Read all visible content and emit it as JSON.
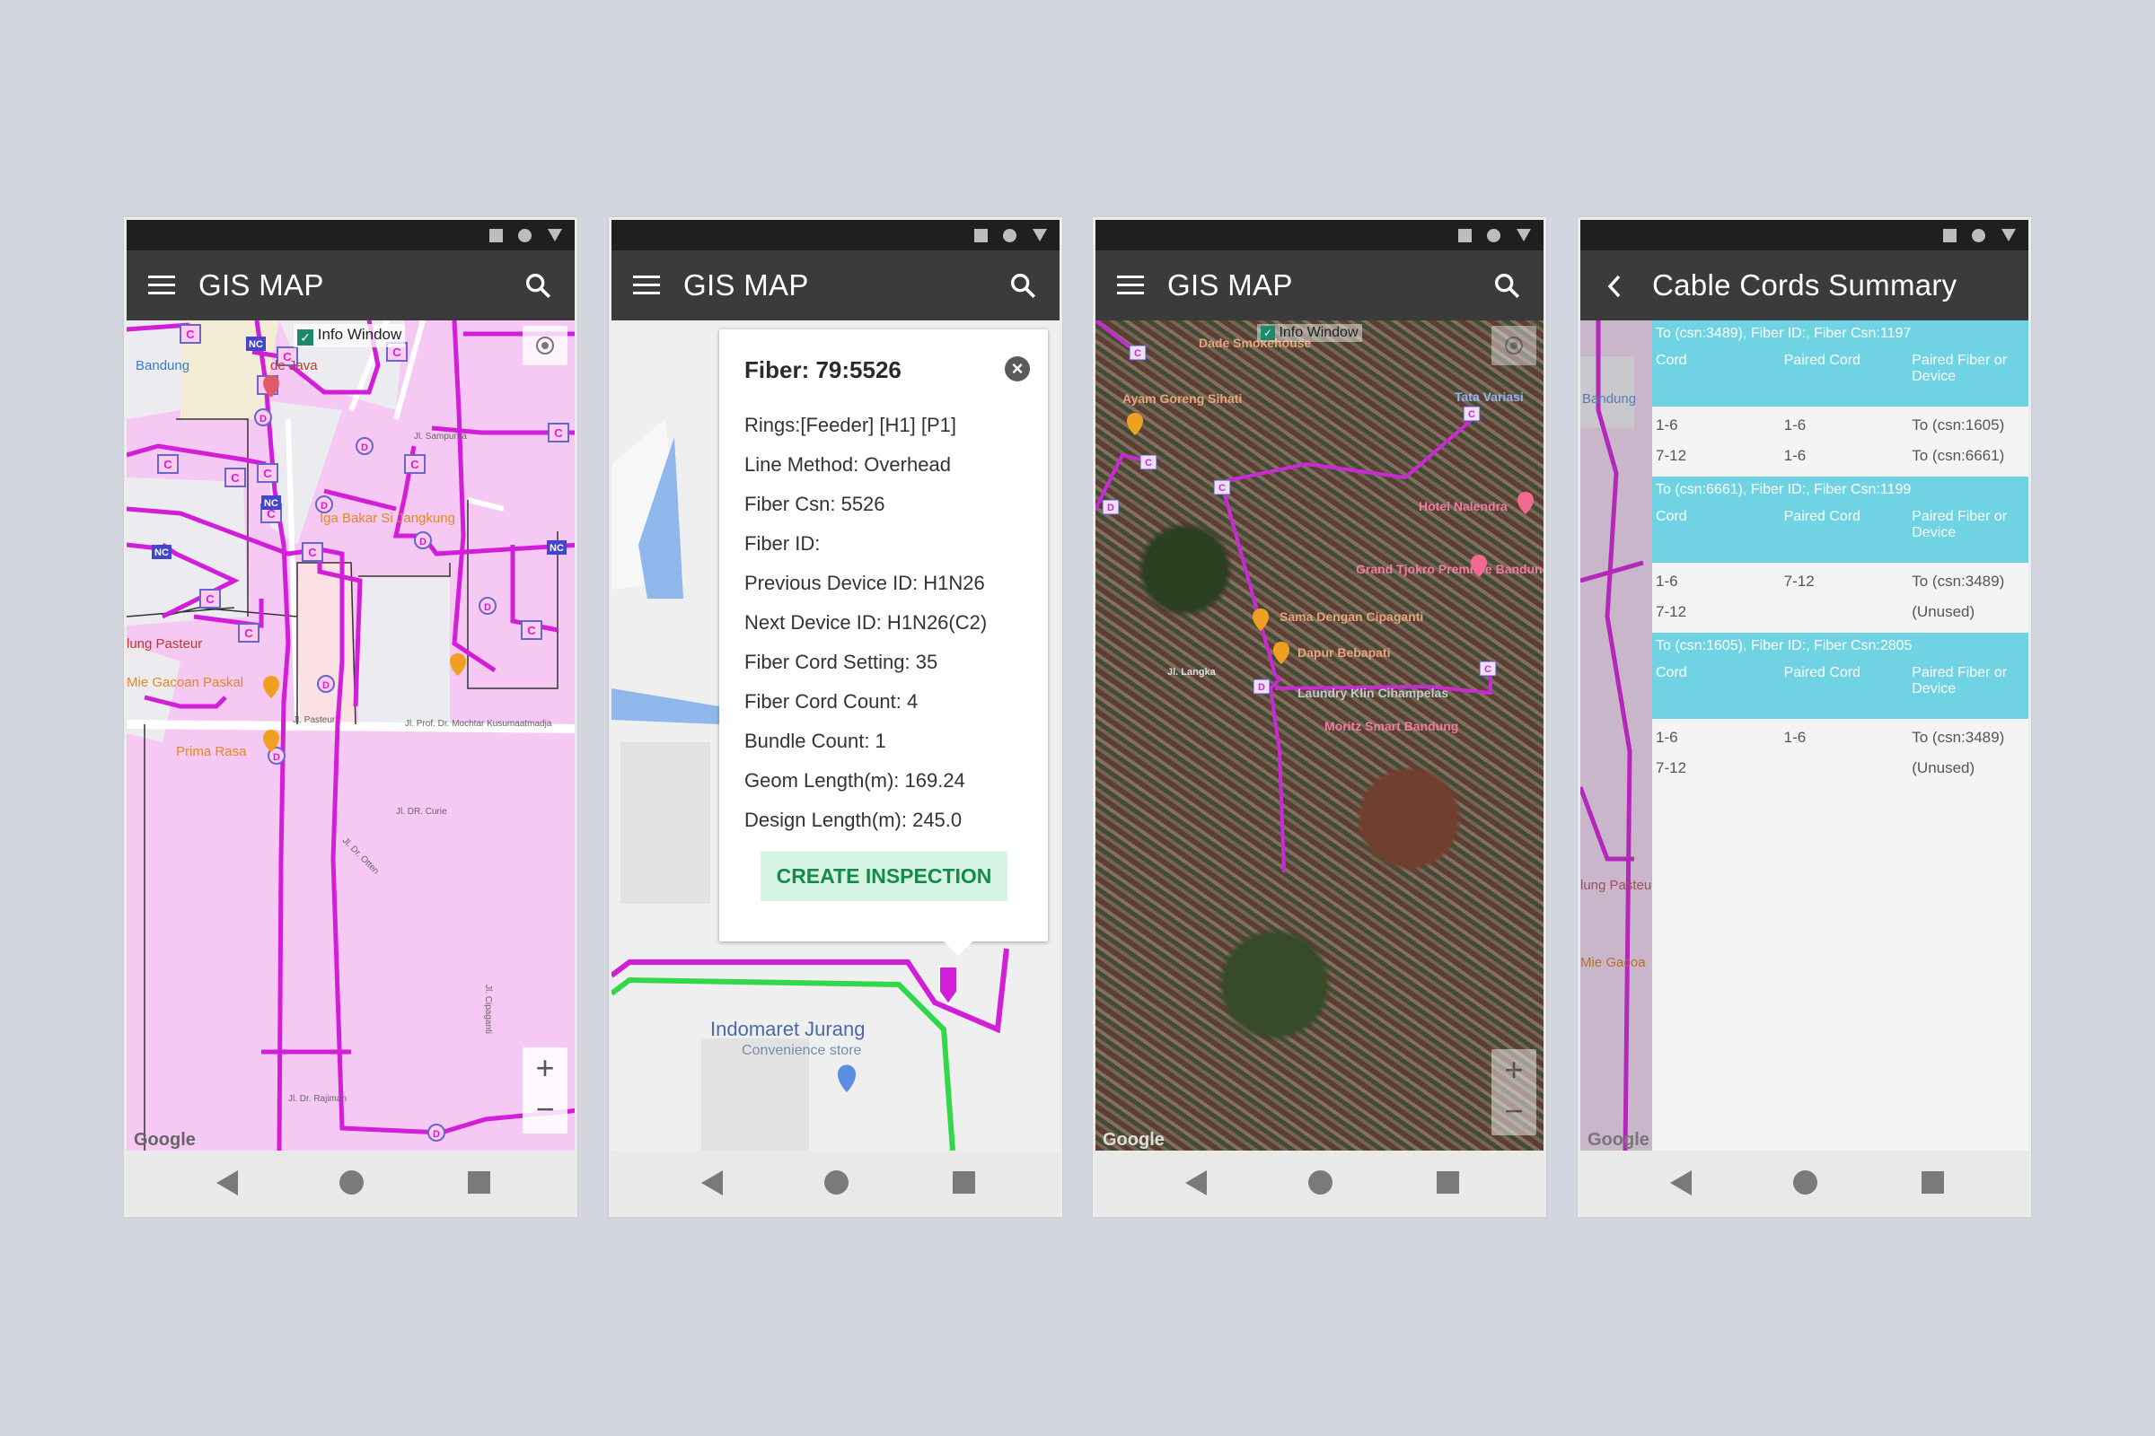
{
  "status_icons": [
    "square-icon",
    "circle-icon",
    "triangle-icon"
  ],
  "nav_icons": [
    "back-triangle-icon",
    "home-circle-icon",
    "recents-square-icon"
  ],
  "colors": {
    "background": "#d3d6de",
    "appbar": "#3b3b3b",
    "fiber_line": "#d21ed8",
    "map_zone": "#f6c8f4",
    "table_header": "#6fd3e3",
    "cta_bg": "#d6f5e4",
    "cta_text": "#168a49",
    "green_route": "#30d84a"
  },
  "screen1": {
    "title": "GIS MAP",
    "info_window_label": "Info Window",
    "info_window_checked": true,
    "map_labels": [
      "Bandung",
      "de Java",
      "Iga Bakar Si Jangkung",
      "lung Pasteur",
      "Mie Gacoan Paskal",
      "Prima Rasa",
      "Jl. Pasteur",
      "Jl. Prof. Dr. Mochtar Kusumaatmadja",
      "Jl. DR. Curie",
      "Jl. Dr. Otten",
      "Jl. Dr. Rajiman",
      "Jl. Sampurna",
      "Jl. Cipaganti"
    ],
    "zoom_in": "+",
    "zoom_out": "−",
    "google": "Google"
  },
  "screen2": {
    "title": "GIS MAP",
    "popup": {
      "title": "Fiber: 79:5526",
      "rows": [
        "Rings:[Feeder] [H1] [P1]",
        "Line Method: Overhead",
        "Fiber Csn: 5526",
        "Fiber ID:",
        "Previous Device ID: H1N26",
        "Next Device ID: H1N26(C2)",
        "Fiber Cord Setting: 35",
        "Fiber Cord Count: 4",
        "Bundle Count: 1",
        "Geom Length(m): 169.24",
        "Design Length(m): 245.0"
      ],
      "button": "CREATE INSPECTION"
    },
    "map_labels": {
      "store": "Indomaret Jurang",
      "store_type": "Convenience store"
    }
  },
  "screen3": {
    "title": "GIS MAP",
    "info_window_label": "Info Window",
    "map_labels": [
      "Dade Smokehouse",
      "Ayam Goreng Sihati",
      "Tata Variasi",
      "Hotel Nalendra",
      "Grand Tjokro Premiere Bandung",
      "Sama Dengan Cipaganti",
      "Dapur Bebapati",
      "Laundry Klin Cihampelas",
      "Moritz Smart Bandung",
      "Jl. Langka"
    ],
    "zoom_in": "+",
    "zoom_out": "−",
    "google": "Google"
  },
  "screen4": {
    "title": "Cable Cords Summary",
    "columns": [
      "Cord",
      "Paired Cord",
      "Paired Fiber or Device"
    ],
    "sections": [
      {
        "caption": "To (csn:3489), Fiber ID:, Fiber Csn:1197",
        "rows": [
          [
            "1-6",
            "1-6",
            "To (csn:1605)"
          ],
          [
            "7-12",
            "1-6",
            "To (csn:6661)"
          ]
        ]
      },
      {
        "caption": "To (csn:6661), Fiber ID:, Fiber Csn:1199",
        "rows": [
          [
            "1-6",
            "7-12",
            "To (csn:3489)"
          ],
          [
            "7-12",
            "",
            "(Unused)"
          ]
        ]
      },
      {
        "caption": "To (csn:1605), Fiber ID:, Fiber Csn:2805",
        "rows": [
          [
            "1-6",
            "1-6",
            "To (csn:3489)"
          ],
          [
            "7-12",
            "",
            "(Unused)"
          ]
        ]
      }
    ],
    "map_labels": [
      "Bandung",
      "lung Pasteu",
      "Mie Gacoa"
    ],
    "google": "Google"
  }
}
